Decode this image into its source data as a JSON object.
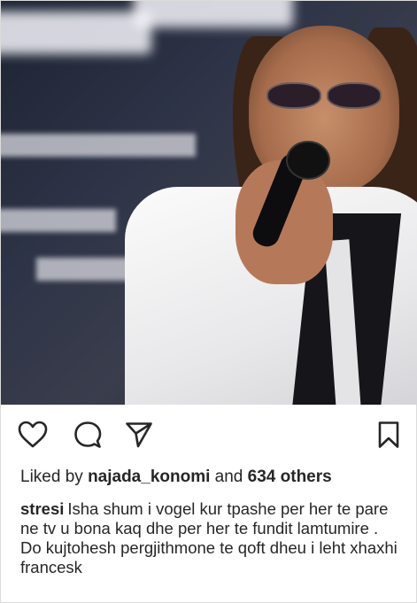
{
  "post": {
    "image_alt_icon": "performer-photo",
    "likes": {
      "prefix": "Liked by",
      "user": "najada_konomi",
      "connector": "and",
      "others": "634 others"
    },
    "caption": {
      "user": "stresi",
      "text": "Isha shum i vogel kur tpashe per her te pare ne tv u bona kaq dhe per her te fundit lamtumire . Do kujtohesh pergjithmone te qoft dheu i leht xhaxhi francesk"
    }
  },
  "icons": {
    "like": "heart-icon",
    "comment": "comment-icon",
    "share": "share-icon",
    "save": "bookmark-icon"
  }
}
